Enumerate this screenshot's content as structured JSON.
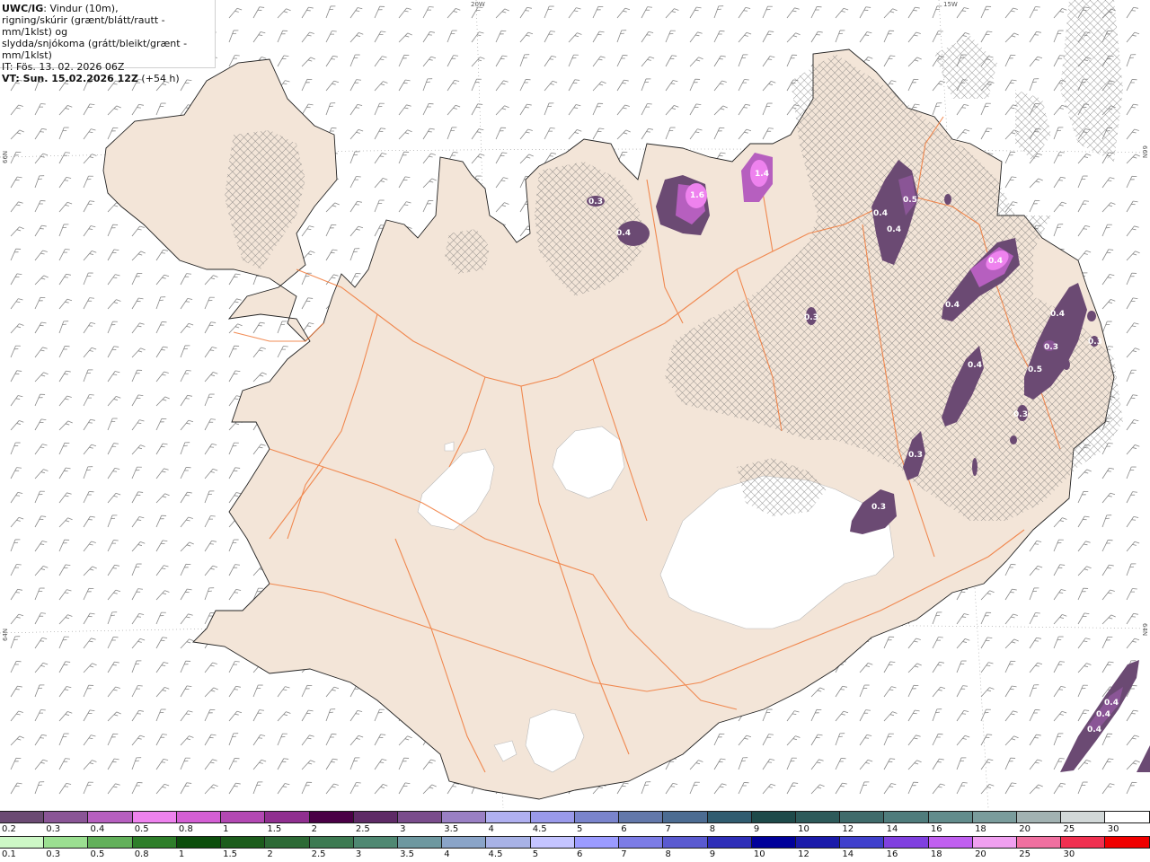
{
  "header": {
    "title_bold": "UWC/IG",
    "title_rest": ": Vindur (10m),",
    "line2": "rigning/skúrir (grænt/blátt/rautt - mm/1klst) og",
    "line3": "slydda/snjókoma (grátt/bleikt/grænt - mm/1klst)",
    "line4": "IT: Fös. 13. 02. 2026 06Z",
    "line5_bold": "VT: Sun. 15.02.2026 12Z",
    "line5_rest": " (+54 h)"
  },
  "grid_labels": {
    "lon_20w": "20W",
    "lon_15w": "15W",
    "lat_66n_left": "66N",
    "lat_66n_right": "66N",
    "lat_64n_left": "64N",
    "lat_64n_right": "64N"
  },
  "precip_labels": [
    "0.3",
    "0.4",
    "1.6",
    "1.4",
    "0.4",
    "0.5",
    "0.4",
    "0.3",
    "0.4",
    "0.4",
    "0.4",
    "0.3",
    "0.4",
    "0.5",
    "0.3",
    "0.3",
    "0.3",
    "0.3",
    "0.4",
    "0.4",
    "0.4"
  ],
  "legend": {
    "snow_ticks": [
      "0.2",
      "0.3",
      "0.4",
      "0.5",
      "0.8",
      "1",
      "1.5",
      "2",
      "2.5",
      "3",
      "3.5",
      "4",
      "4.5",
      "5",
      "6",
      "7",
      "8",
      "9",
      "10",
      "12",
      "14",
      "16",
      "18",
      "20",
      "25",
      "30"
    ],
    "snow_colors": [
      "#6b4a73",
      "#8a5596",
      "#b65fbf",
      "#ee82ee",
      "#d45fd4",
      "#b348b3",
      "#902f90",
      "#4a0046",
      "#5e2a66",
      "#7a4c8c",
      "#9a80c4",
      "#b0b0f0",
      "#9a9aea",
      "#7a84cc",
      "#6378aa",
      "#4c6c92",
      "#305c70",
      "#1e4a4a",
      "#2d5a5a",
      "#3f6b6b",
      "#4f7c7c",
      "#628c8c",
      "#7a9c9c",
      "#a2b2b2",
      "#d2d8d8",
      "#ffffff"
    ],
    "rain_ticks": [
      "0.1",
      "0.3",
      "0.5",
      "0.8",
      "1",
      "1.5",
      "2",
      "2.5",
      "3",
      "3.5",
      "4",
      "4.5",
      "5",
      "6",
      "7",
      "8",
      "9",
      "10",
      "12",
      "14",
      "16",
      "18",
      "20",
      "25",
      "30"
    ],
    "rain_colors": [
      "#cdf7c6",
      "#9bdf91",
      "#62b05a",
      "#2e7e2a",
      "#0c4e0c",
      "#1c5c1c",
      "#2d6a36",
      "#3d7a52",
      "#4f8872",
      "#6e98a0",
      "#8aa4c8",
      "#a8b2e6",
      "#c4c4ff",
      "#9b9bff",
      "#7c7ce6",
      "#5a5ad0",
      "#2e2eb8",
      "#00009a",
      "#1a1aaa",
      "#4040cc",
      "#8040e0",
      "#c060f0",
      "#f0a0f0",
      "#f070a0",
      "#f03050",
      "#f00000"
    ]
  },
  "map_colors": {
    "sea": "#ffffff",
    "land": "#f3e5d8",
    "coast": "#222222",
    "roads": "#f07838",
    "glacier": "#ffffff",
    "hatch": "#777777"
  }
}
